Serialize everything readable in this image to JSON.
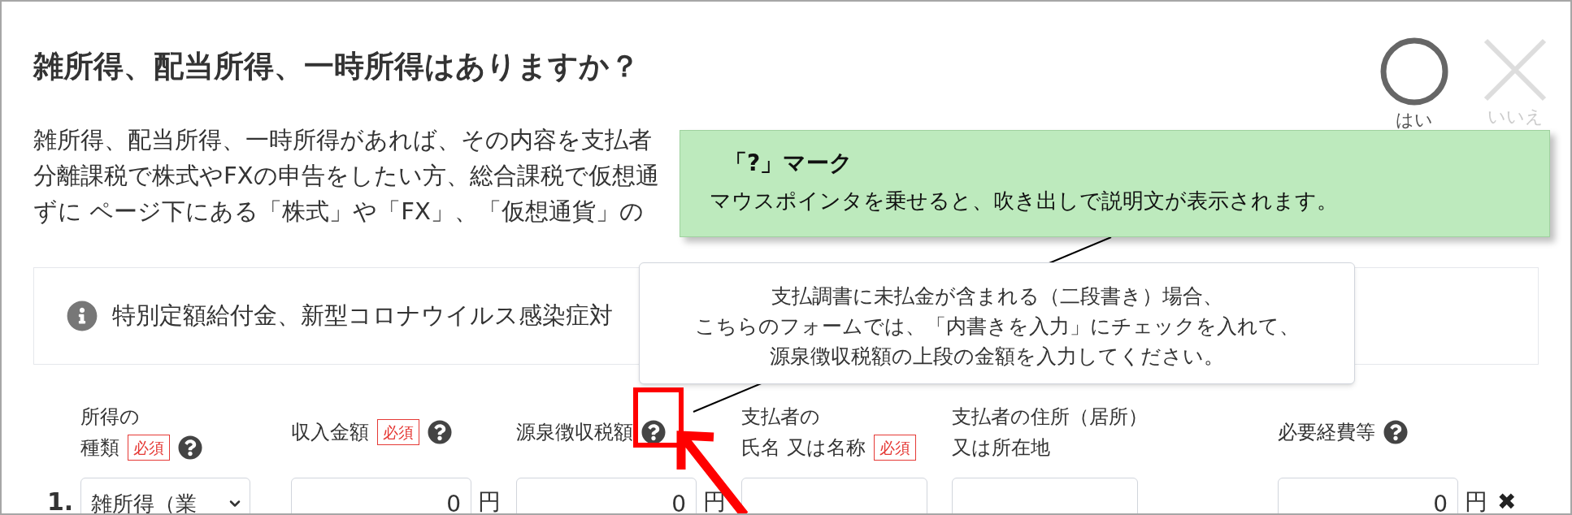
{
  "question": {
    "title": "雑所得、配当所得、一時所得はありますか？",
    "answers": [
      {
        "kind": "circle",
        "label": "はい",
        "selected": true
      },
      {
        "kind": "cross",
        "label": "いいえ",
        "selected": false
      }
    ]
  },
  "description": [
    "雑所得、配当所得、一時所得があれば、その内容を支払者",
    "分離課税で株式やFXの申告をしたい方、総合課税で仮想通",
    "ずに ページ下にある「株式」や「FX」、「仮想通貨」の"
  ],
  "notice": {
    "text": "特別定額給付金、新型コロナウイルス感染症対"
  },
  "table": {
    "columns": [
      {
        "lines": [
          "所得の",
          "種類"
        ],
        "badge": "必須",
        "help": true
      },
      {
        "lines": [
          "収入金額"
        ],
        "badge": "必須",
        "help": true
      },
      {
        "lines": [
          "源泉徴収税額"
        ],
        "help": true,
        "highlighted": true
      },
      {
        "lines": [
          "支払者の",
          "氏名 又は名称"
        ],
        "badge": "必須",
        "help": false
      },
      {
        "lines": [
          "支払者の住所（居所）",
          "又は所在地"
        ],
        "help": false
      },
      {
        "lines": [
          "必要経費等"
        ],
        "help": true
      }
    ],
    "rows": [
      {
        "number": "1.",
        "delete": "✖",
        "cells": [
          {
            "kind": "select",
            "value": "雑所得（業"
          },
          {
            "kind": "amount",
            "value": "0",
            "unit": "円"
          },
          {
            "kind": "amount",
            "value": "0",
            "unit": "円"
          },
          {
            "kind": "text"
          },
          {
            "kind": "text"
          },
          {
            "kind": "amount",
            "value": "0",
            "unit": "円"
          }
        ]
      }
    ]
  },
  "tooltip": {
    "lines": [
      "支払調書に未払金が含まれる（二段書き）場合、",
      "こちらのフォームでは、「内書きを入力」にチェックを入れて、",
      "源泉徴収税額の上段の金額を入力してください。"
    ]
  },
  "callout": {
    "title": "「?」マーク",
    "text": "マウスポインタを乗せると、吹き出しで説明文が表示されます。"
  }
}
